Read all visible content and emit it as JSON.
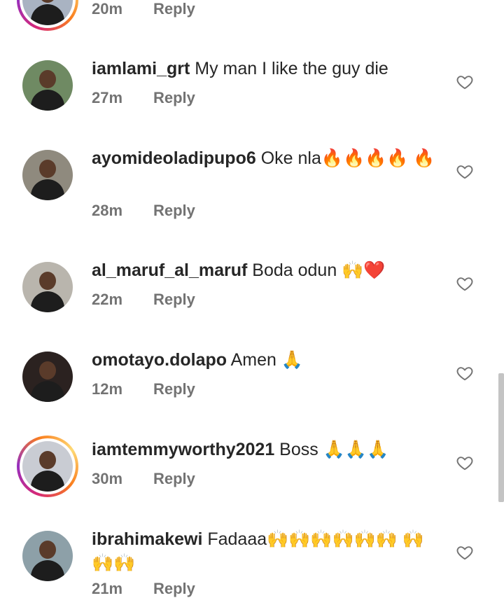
{
  "comments": [
    {
      "username": "",
      "text": "",
      "time": "20m",
      "reply": "Reply",
      "ring": true,
      "bg": "#a9b3c2"
    },
    {
      "username": "iamlami_grt",
      "text": " My man I like the guy die",
      "time": "27m",
      "reply": "Reply",
      "ring": false,
      "bg": "#6f8a63"
    },
    {
      "username": "ayomideoladipupo6",
      "text": " Oke nla🔥🔥🔥🔥 🔥",
      "time": "28m",
      "reply": "Reply",
      "ring": false,
      "bg": "#8f8a7e"
    },
    {
      "username": "al_maruf_al_maruf",
      "text": " Boda odun 🙌❤️",
      "time": "22m",
      "reply": "Reply",
      "ring": false,
      "bg": "#b9b5ad"
    },
    {
      "username": "omotayo.dolapo",
      "text": " Amen 🙏",
      "time": "12m",
      "reply": "Reply",
      "ring": false,
      "bg": "#2b2220"
    },
    {
      "username": "iamtemmyworthy2021",
      "text": " Boss 🙏🙏🙏",
      "time": "30m",
      "reply": "Reply",
      "ring": true,
      "bg": "#c9ccd3"
    },
    {
      "username": "ibrahimakewi",
      "text": " Fadaaa🙌🙌🙌🙌🙌🙌 🙌🙌🙌",
      "time": "21m",
      "reply": "Reply",
      "ring": false,
      "bg": "#8da0a8"
    }
  ],
  "icons": {
    "like": "heart-outline-icon",
    "avatar": "user-avatar"
  },
  "colors": {
    "ring": "#d62976",
    "meta": "#737373",
    "text": "#262626"
  }
}
